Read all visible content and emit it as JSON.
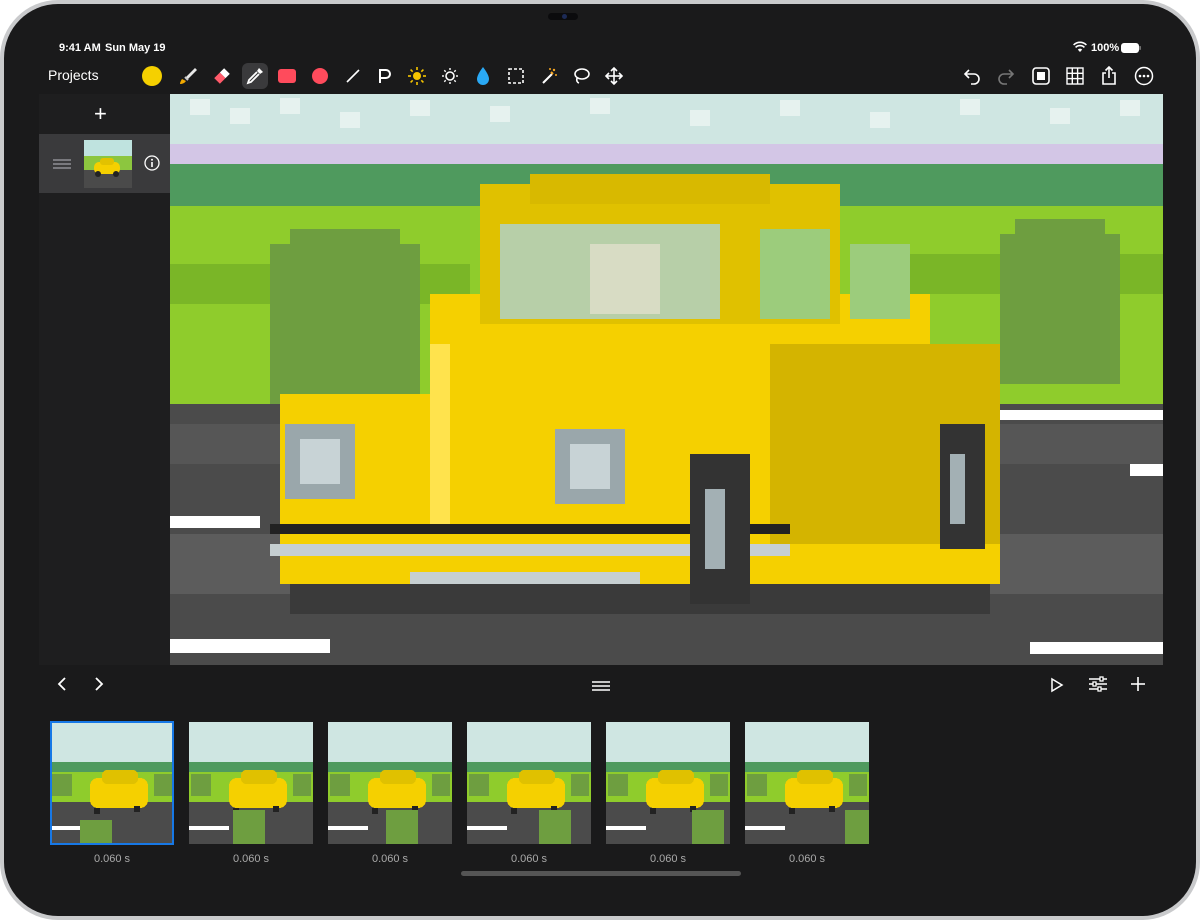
{
  "status_bar": {
    "time": "9:41 AM",
    "date": "Sun May 19",
    "battery": "100%"
  },
  "toolbar": {
    "projects_label": "Projects",
    "current_color": "#f5d000",
    "tools": [
      "color-swatch",
      "brush",
      "eraser",
      "eyedropper",
      "rectangle",
      "ellipse",
      "line",
      "text-tool",
      "brightness",
      "darken",
      "fill-drop",
      "selection",
      "magic-wand",
      "lasso",
      "move"
    ],
    "selected_tool": "eyedropper",
    "right_tools": [
      "undo",
      "redo",
      "canvas-fit",
      "grid",
      "share",
      "more"
    ]
  },
  "layers": {
    "add_label": "+"
  },
  "frames": {
    "items": [
      {
        "duration": "0.060 s"
      },
      {
        "duration": "0.060 s"
      },
      {
        "duration": "0.060 s"
      },
      {
        "duration": "0.060 s"
      },
      {
        "duration": "0.060 s"
      },
      {
        "duration": "0.060 s"
      }
    ],
    "selected_index": 0
  },
  "colors": {
    "accent": "#1778e6",
    "car_yellow": "#f5d000",
    "grass": "#8cc63f",
    "road": "#4a4a4a"
  }
}
